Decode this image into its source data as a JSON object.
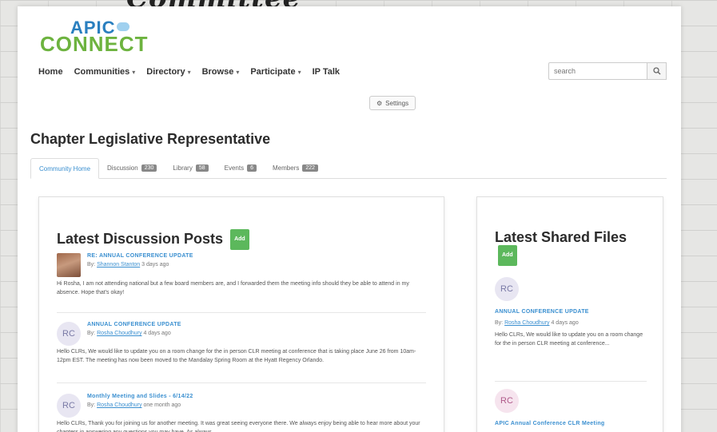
{
  "overlay": {
    "text": "Committee"
  },
  "logo": {
    "line1": "APIC",
    "line2": "CONNECT"
  },
  "nav": {
    "items": [
      {
        "label": "Home",
        "caret": false
      },
      {
        "label": "Communities",
        "caret": true
      },
      {
        "label": "Directory",
        "caret": true
      },
      {
        "label": "Browse",
        "caret": true
      },
      {
        "label": "Participate",
        "caret": true
      },
      {
        "label": "IP Talk",
        "caret": false
      }
    ]
  },
  "search": {
    "placeholder": "search"
  },
  "settings": {
    "label": "Settings"
  },
  "page": {
    "title": "Chapter Legislative Representative"
  },
  "tabs": [
    {
      "label": "Community Home",
      "count": ""
    },
    {
      "label": "Discussion",
      "count": "230"
    },
    {
      "label": "Library",
      "count": "58"
    },
    {
      "label": "Events",
      "count": "6"
    },
    {
      "label": "Members",
      "count": "222"
    }
  ],
  "discussion": {
    "heading": "Latest Discussion Posts",
    "add_label": "Add",
    "posts": [
      {
        "avatar": "photo",
        "title": "RE: ANNUAL CONFERENCE UPDATE",
        "by": "By:",
        "author": "Shannon Stanton",
        "time": "3 days ago",
        "body": "Hi Rosha, I am not attending national but a few board members are, and I forwarded them the meeting info should they be able to attend in my absence. Hope that's okay!"
      },
      {
        "avatar": "RC",
        "title": "ANNUAL CONFERENCE UPDATE",
        "by": "By:",
        "author": "Rosha Choudhury",
        "time": "4 days ago",
        "body": "Hello CLRs, We would like to update you on a room change for the in person CLR meeting at conference that is taking place June 26 from 10am-12pm EST. The meeting has now been moved to the Mandalay Spring Room at the Hyatt Regency Orlando."
      },
      {
        "avatar": "RC",
        "title": "Monthly Meeting and Slides - 6/14/22",
        "by": "By:",
        "author": "Rosha Choudhury",
        "time": "one month ago",
        "body": "Hello CLRs, Thank you for joining us for another meeting. It was great seeing everyone there. We always enjoy being able to hear more about your chapters in answering any questions you may have. As always,"
      }
    ]
  },
  "files": {
    "heading": "Latest Shared Files",
    "add_label": "Add",
    "items": [
      {
        "avatar": "RC",
        "title": "ANNUAL CONFERENCE UPDATE",
        "by": "By:",
        "author": "Rosha Choudhury",
        "time": "4 days ago",
        "body": "Hello CLRs, We would like to update you on a room change for the in person CLR meeting at conference..."
      },
      {
        "avatar": "RC",
        "title": "APIC Annual Conference CLR Meeting",
        "by": "",
        "author": "",
        "time": "",
        "body": ""
      }
    ]
  }
}
